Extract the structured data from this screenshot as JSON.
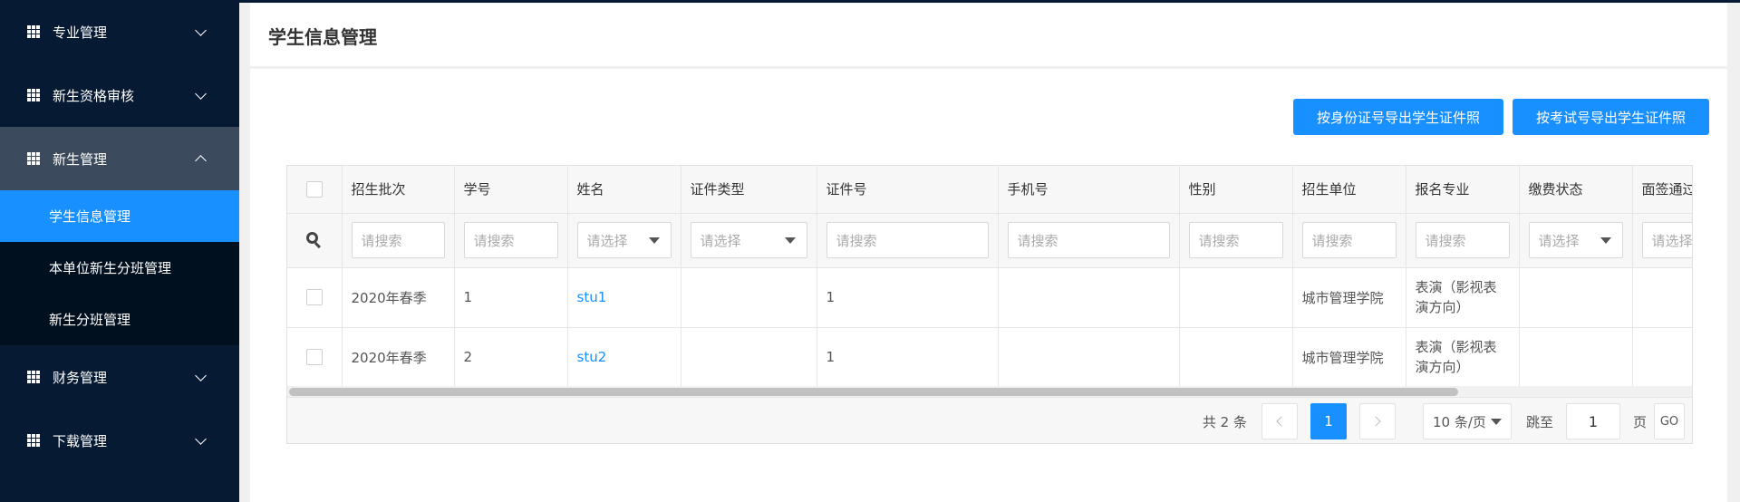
{
  "sidebar": {
    "menus": [
      {
        "label": "专业管理",
        "expanded": false
      },
      {
        "label": "新生资格审核",
        "expanded": false
      },
      {
        "label": "新生管理",
        "expanded": true,
        "children": [
          {
            "label": "学生信息管理",
            "active": true
          },
          {
            "label": "本单位新生分班管理",
            "active": false
          },
          {
            "label": "新生分班管理",
            "active": false
          }
        ]
      },
      {
        "label": "财务管理",
        "expanded": false
      },
      {
        "label": "下载管理",
        "expanded": false
      }
    ]
  },
  "page": {
    "title": "学生信息管理",
    "buttons": {
      "export_by_id": "按身份证号导出学生证件照",
      "export_by_exam": "按考试号导出学生证件照"
    }
  },
  "table": {
    "columns": [
      "招生批次",
      "学号",
      "姓名",
      "证件类型",
      "证件号",
      "手机号",
      "性别",
      "招生单位",
      "报名专业",
      "缴费状态",
      "面签通过"
    ],
    "filters": {
      "search_placeholder": "请搜索",
      "select_placeholder": "请选择"
    },
    "rows": [
      {
        "batch": "2020年春季",
        "student_no": "1",
        "name": "stu1",
        "id_type": "",
        "id_no": "1",
        "phone": "",
        "gender": "",
        "unit": "城市管理学院",
        "major": "表演（影视表演方向）",
        "fee": "",
        "interview": ""
      },
      {
        "batch": "2020年春季",
        "student_no": "2",
        "name": "stu2",
        "id_type": "",
        "id_no": "1",
        "phone": "",
        "gender": "",
        "unit": "城市管理学院",
        "major": "表演（影视表演方向）",
        "fee": "",
        "interview": ""
      }
    ]
  },
  "pagination": {
    "total_text": "共 2 条",
    "current_page": "1",
    "page_size": "10 条/页",
    "jump_label": "跳至",
    "jump_value": "1",
    "page_unit": "页",
    "go_label": "GO"
  },
  "colors": {
    "sidebar_bg": "#071a33",
    "accent": "#1890ff",
    "expanded_bg": "#3b4a5c"
  }
}
